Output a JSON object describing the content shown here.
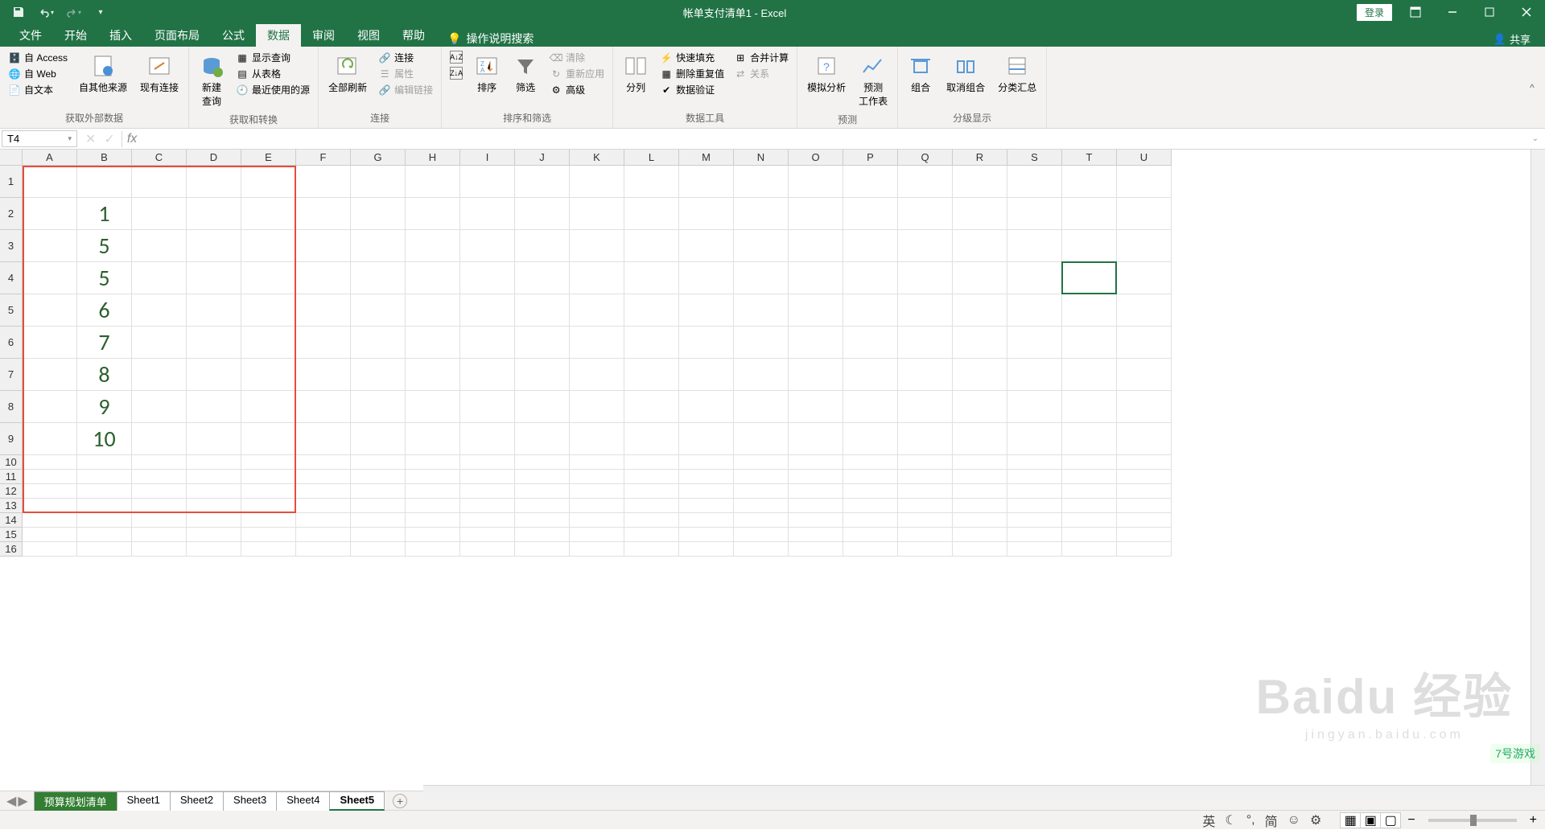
{
  "title_bar": {
    "doc_title": "帐单支付清单1 - Excel",
    "login": "登录"
  },
  "tabs": {
    "file": "文件",
    "home": "开始",
    "insert": "插入",
    "layout": "页面布局",
    "formulas": "公式",
    "data": "数据",
    "review": "审阅",
    "view": "视图",
    "help": "帮助",
    "tellme": "操作说明搜索",
    "share": "共享"
  },
  "ribbon": {
    "ext_data": {
      "access": "自 Access",
      "web": "自 Web",
      "text": "自文本",
      "other": "自其他来源",
      "existing": "现有连接",
      "title": "获取外部数据"
    },
    "get_trans": {
      "new_query": "新建\n查询",
      "show_query": "显示查询",
      "from_table": "从表格",
      "recent": "最近使用的源",
      "title": "获取和转换"
    },
    "conn": {
      "refresh": "全部刷新",
      "connections": "连接",
      "properties": "属性",
      "edit_links": "编辑链接",
      "title": "连接"
    },
    "sort": {
      "sort": "排序",
      "filter": "筛选",
      "clear": "清除",
      "reapply": "重新应用",
      "advanced": "高级",
      "title": "排序和筛选"
    },
    "tools": {
      "split": "分列",
      "flash": "快速填充",
      "dedup": "删除重复值",
      "validate": "数据验证",
      "consolidate": "合并计算",
      "relationships": "关系",
      "title": "数据工具"
    },
    "forecast": {
      "whatif": "模拟分析",
      "forecast": "预测\n工作表",
      "title": "预测"
    },
    "outline": {
      "group": "组合",
      "ungroup": "取消组合",
      "subtotal": "分类汇总",
      "title": "分级显示"
    }
  },
  "name_box": "T4",
  "columns": [
    "A",
    "B",
    "C",
    "D",
    "E",
    "F",
    "G",
    "H",
    "I",
    "J",
    "K",
    "L",
    "M",
    "N",
    "O",
    "P",
    "Q",
    "R",
    "S",
    "T",
    "U"
  ],
  "rows_tall": [
    "1",
    "2",
    "3",
    "4",
    "5",
    "6",
    "7",
    "8",
    "9"
  ],
  "rows_short": [
    "10",
    "11",
    "12",
    "13",
    "14",
    "15",
    "16"
  ],
  "cell_data_b": [
    "",
    "1",
    "5",
    "5",
    "6",
    "7",
    "8",
    "9",
    "10"
  ],
  "active_cell": {
    "col": "T",
    "row": 4
  },
  "red_box": {
    "from_col": "A",
    "to_col": "E",
    "from_row": 1,
    "to_row": 13
  },
  "sheets": {
    "s0": "预算规划清单",
    "s1": "Sheet1",
    "s2": "Sheet2",
    "s3": "Sheet3",
    "s4": "Sheet4",
    "s5": "Sheet5"
  },
  "ime": {
    "lang": "英",
    "mode": "简"
  },
  "watermark": {
    "main": "Baidu 经验",
    "sub": "jingyan.baidu.com"
  },
  "corner_wm": "7号游戏"
}
